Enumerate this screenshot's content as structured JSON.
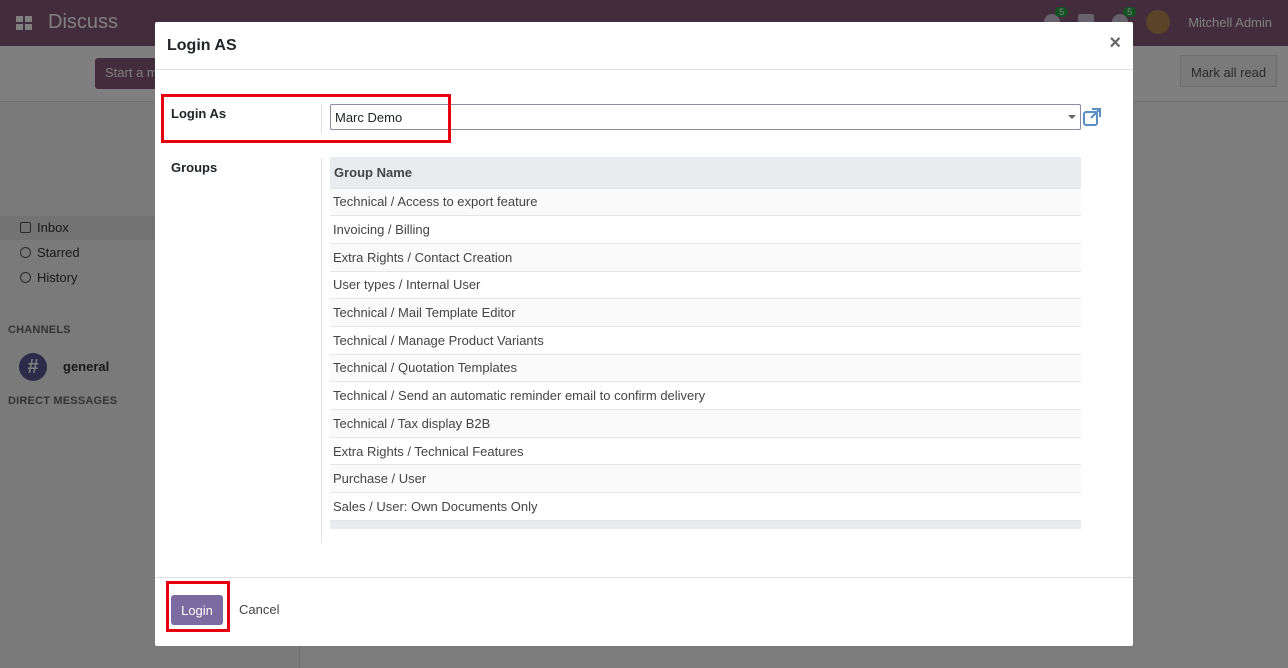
{
  "app": {
    "title": "Discuss",
    "user_name": "Mitchell Admin",
    "badges": [
      "5",
      "5"
    ],
    "start_label": "Start a m",
    "mark_all_read": "Mark all read"
  },
  "sidebar": {
    "items": [
      {
        "label": "Inbox",
        "icon": "inbox-icon"
      },
      {
        "label": "Starred",
        "icon": "star-icon"
      },
      {
        "label": "History",
        "icon": "history-icon"
      }
    ],
    "channels_header": "CHANNELS",
    "channel": {
      "name": "general",
      "symbol": "#"
    },
    "dm_header": "DIRECT MESSAGES"
  },
  "modal": {
    "title": "Login AS",
    "close_glyph": "×",
    "login_as_label": "Login As",
    "login_as_value": "Marc Demo",
    "groups_label": "Groups",
    "groups_header": "Group Name",
    "groups": [
      "Technical / Access to export feature",
      "Invoicing / Billing",
      "Extra Rights / Contact Creation",
      "User types / Internal User",
      "Technical / Mail Template Editor",
      "Technical / Manage Product Variants",
      "Technical / Quotation Templates",
      "Technical / Send an automatic reminder email to confirm delivery",
      "Technical / Tax display B2B",
      "Extra Rights / Technical Features",
      "Purchase / User",
      "Sales / User: Own Documents Only"
    ],
    "login_button": "Login",
    "cancel_button": "Cancel"
  },
  "colors": {
    "brand": "#875a7b",
    "primary_button": "#7c6ba0",
    "highlight": "#e6000f"
  }
}
